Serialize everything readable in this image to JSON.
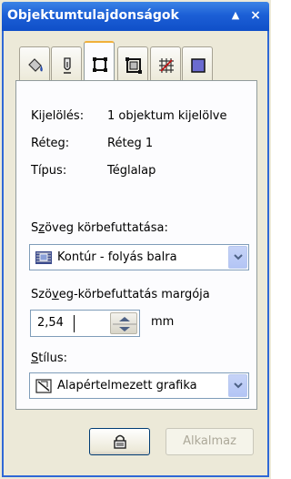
{
  "window": {
    "title": "Objektumtulajdonságok",
    "pin_glyph": "▲",
    "close_glyph": "×"
  },
  "tabs": [
    {
      "icon": "fill-bucket-icon"
    },
    {
      "icon": "pen-outline-icon"
    },
    {
      "icon": "rectangle-nodes-icon",
      "active": true
    },
    {
      "icon": "rectangle-frame-icon"
    },
    {
      "icon": "wrap-grid-icon"
    },
    {
      "icon": "square-general-icon"
    }
  ],
  "info": {
    "selection_label": "Kijelölés:",
    "selection_value": "1 objektum kijelölve",
    "layer_label": "Réteg:",
    "layer_value": "Réteg 1",
    "type_label": "Típus:",
    "type_value": "Téglalap"
  },
  "text_wrap": {
    "label_pre": "S",
    "label_u": "z",
    "label_post": "öveg körbefuttatása:",
    "selected": "Kontúr - folyás balra"
  },
  "margin": {
    "label_pre": "Szö",
    "label_u": "v",
    "label_post": "eg-körbefuttatás margója",
    "value": "2,54",
    "unit": "mm"
  },
  "style": {
    "label_pre": "",
    "label_u": "S",
    "label_post": "tílus:",
    "selected": "Alapértelmezett grafika"
  },
  "buttons": {
    "apply_label": "Alkalmaz"
  },
  "colors": {
    "title_bar": "#1c5fd6",
    "panel_bg": "#ece9d8",
    "active_tab_accent": "#f0b03a"
  }
}
